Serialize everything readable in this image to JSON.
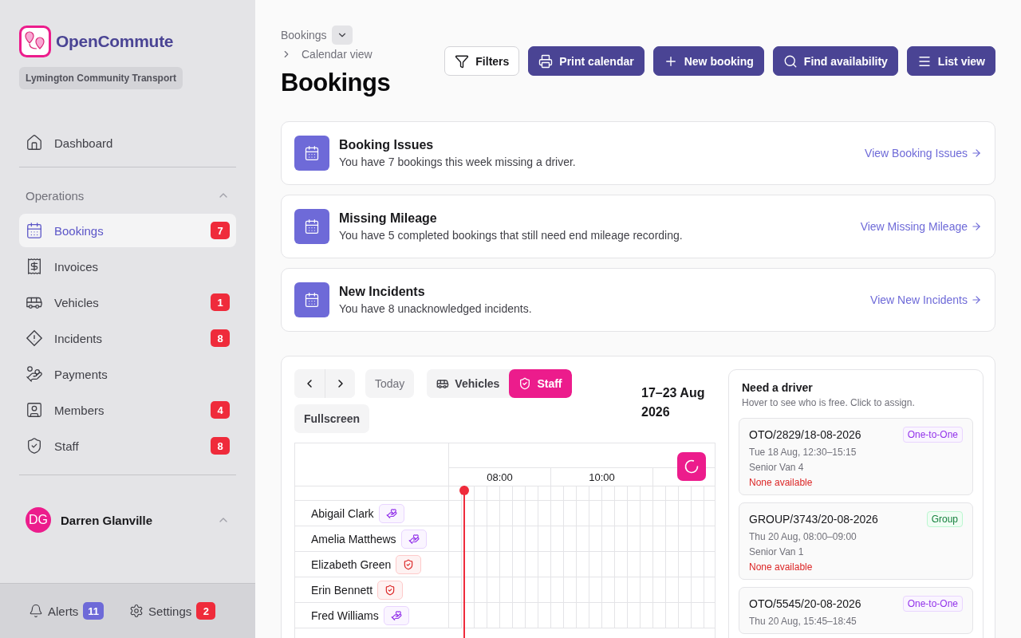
{
  "brand": {
    "name": "OpenCommute",
    "organisation": "Lymington Community Transport"
  },
  "nav": {
    "top": [
      {
        "label": "Dashboard",
        "selected": false
      }
    ],
    "section": {
      "title": "Operations",
      "expanded": true,
      "items": [
        {
          "label": "Bookings",
          "badge": "7",
          "selected": true
        },
        {
          "label": "Invoices",
          "selected": false
        },
        {
          "label": "Vehicles",
          "badge": "1",
          "selected": false
        },
        {
          "label": "Incidents",
          "badge": "8",
          "selected": false
        },
        {
          "label": "Payments",
          "selected": false
        },
        {
          "label": "Members",
          "badge": "4",
          "selected": false
        },
        {
          "label": "Staff",
          "badge": "8",
          "selected": false
        }
      ]
    }
  },
  "user": {
    "initials": "DG",
    "name": "Darren Glanville",
    "expanded": true
  },
  "footer": [
    {
      "label": "Alerts",
      "badge": "11",
      "color": "#6e6ad8"
    },
    {
      "label": "Settings",
      "badge": "2",
      "color": "#ef2b3b"
    }
  ],
  "breadcrumb": {
    "root": "Bookings",
    "current": "Calendar view"
  },
  "title": "Bookings",
  "actions": [
    {
      "label": "Filters",
      "kind": "outline"
    },
    {
      "label": "Print calendar",
      "kind": "solid"
    },
    {
      "label": "New booking",
      "kind": "solid"
    },
    {
      "label": "Find availability",
      "kind": "solid"
    },
    {
      "label": "List view",
      "kind": "solid"
    }
  ],
  "notices": [
    {
      "title": "Booking Issues",
      "text": "You have 7 bookings this week missing a driver.",
      "link": "View Booking Issues"
    },
    {
      "title": "Missing Mileage",
      "text": "You have 5 completed bookings that still need end mileage recording.",
      "link": "View Missing Mileage"
    },
    {
      "title": "New Incidents",
      "text": "You have 8 unacknowledged incidents.",
      "link": "View New Incidents"
    }
  ],
  "calendar": {
    "today": "Today",
    "modes": [
      {
        "label": "Vehicles",
        "selected": false
      },
      {
        "label": "Staff",
        "selected": true
      }
    ],
    "fullscreen": "Fullscreen",
    "range": "17–23 Aug 2026",
    "times": [
      "08:00",
      "10:00"
    ],
    "staff": [
      {
        "name": "Abigail Clark",
        "kind": "volunteer"
      },
      {
        "name": "Amelia Matthews",
        "kind": "volunteer"
      },
      {
        "name": "Elizabeth Green",
        "kind": "staff"
      },
      {
        "name": "Erin Bennett",
        "kind": "staff"
      },
      {
        "name": "Fred Williams",
        "kind": "volunteer"
      }
    ]
  },
  "need_driver": {
    "title": "Need a driver",
    "hint": "Hover to see who is free. Click to assign.",
    "bookings": [
      {
        "ref": "OTO/2829/18-08-2026",
        "type": {
          "label": "One-to-One",
          "kind": "one-to-one"
        },
        "when": "Tue 18 Aug, 12:30–15:15",
        "vehicle": "Senior Van 4",
        "status": "None available"
      },
      {
        "ref": "GROUP/3743/20-08-2026",
        "type": {
          "label": "Group",
          "kind": "group"
        },
        "when": "Thu 20 Aug, 08:00–09:00",
        "vehicle": "Senior Van 1",
        "status": "None available"
      },
      {
        "ref": "OTO/5545/20-08-2026",
        "type": {
          "label": "One-to-One",
          "kind": "one-to-one"
        },
        "when": "Thu 20 Aug, 15:45–18:45"
      }
    ]
  }
}
